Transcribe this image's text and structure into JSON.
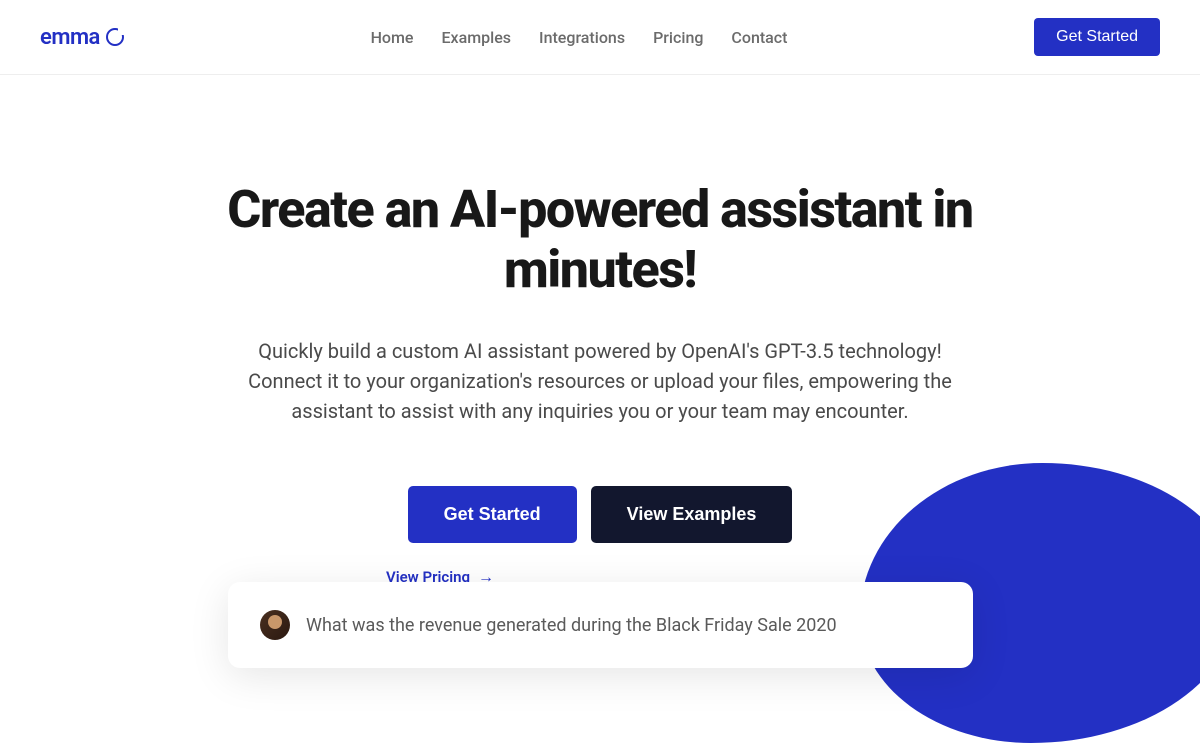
{
  "logo": {
    "text": "emma"
  },
  "nav": {
    "items": [
      "Home",
      "Examples",
      "Integrations",
      "Pricing",
      "Contact"
    ]
  },
  "header_cta": "Get Started",
  "hero": {
    "title": "Create an AI-powered assistant in minutes!",
    "description": "Quickly build a custom AI assistant powered by OpenAI's GPT-3.5 technology! Connect it to your organization's resources or upload your files, empowering the assistant to assist with any inquiries you or your team may encounter.",
    "cta_primary": "Get Started",
    "cta_secondary": "View Examples",
    "pricing_link": "View Pricing"
  },
  "chat": {
    "message": "What was the revenue generated during the Black Friday Sale 2020"
  }
}
